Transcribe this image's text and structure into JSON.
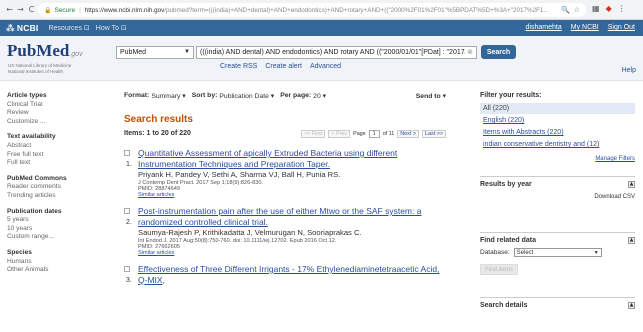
{
  "browser": {
    "back": "←",
    "forward": "→",
    "reload": "C",
    "secure_label": "Secure",
    "url_host": "https://www.ncbi.nlm.nih.gov",
    "url_path": "/pubmed?term=(((india)+AND+dental)+AND+endodontics)+AND+rotary+AND+((\"2000%2F01%2F01\"%5BPDAT%5D+%3A+\"2017%2F1..."
  },
  "ncbi": {
    "logo": "NCBI",
    "resources": "Resources ⊡",
    "howto": "How To ⊡",
    "username": "dishamehta",
    "my_ncbi": "My NCBI",
    "sign_out": "Sign Out"
  },
  "search": {
    "logo_pub": "Pub",
    "logo_med": "Med",
    "logo_gov": ".gov",
    "subtitle_1": "US National Library of Medicine",
    "subtitle_2": "National Institutes of Health",
    "database": "PubMed",
    "query": "(((india) AND dental) AND endodontics) AND rotary AND ((\"2000/01/01\"[PDat] : \"2017/",
    "search_button": "Search",
    "create_rss": "Create RSS",
    "create_alert": "Create alert",
    "advanced": "Advanced",
    "help": "Help"
  },
  "sidebar": [
    {
      "heading": "Article types",
      "items": [
        "Clinical Trial",
        "Review",
        "Customize ..."
      ]
    },
    {
      "heading": "Text availability",
      "items": [
        "Abstract",
        "Free full text",
        "Full text"
      ]
    },
    {
      "heading": "PubMed Commons",
      "items": [
        "Reader comments",
        "Trending articles"
      ]
    },
    {
      "heading": "Publication dates",
      "items": [
        "5 years",
        "10 years",
        "Custom range..."
      ]
    },
    {
      "heading": "Species",
      "items": [
        "Humans",
        "Other Animals"
      ]
    }
  ],
  "main": {
    "format_label": "Format:",
    "format_value": "Summary ▾",
    "sort_label": "Sort by:",
    "sort_value": "Publication Date ▾",
    "perpage_label": "Per page:",
    "perpage_value": "20 ▾",
    "send_to": "Send to ▾",
    "results_title": "Search results",
    "items_text": "Items: 1 to 20 of 220",
    "pager": {
      "first": "<< First",
      "prev": "< Prev",
      "page_label": "Page",
      "page_value": "1",
      "of_text": "of 11",
      "next": "Next >",
      "last": "Last >>"
    },
    "results": [
      {
        "num": "1.",
        "title": "Quantitative Assessment of apically Extruded Bacteria using different Instrumentation Techniques and Preparation Taper.",
        "authors": "Priyank H, Pandey V, Sethi A, Sharma VJ, Ball H, Punia RS.",
        "citation": "J Contemp Dent Pract. 2017 Sep 1;18(9):826-830.",
        "pmid": "PMID: 28874649",
        "similar": "Similar articles"
      },
      {
        "num": "2.",
        "title": "Post-instrumentation pain after the use of either Mtwo or the SAF system: a randomized controlled clinical trial.",
        "authors": "Saumya-Rajesh P, Krithikadatta J, Velmurugan N, Sooriaprakas C.",
        "citation": "Int Endod J. 2017 Aug;50(8):750-760. doi: 10.1111/iej.12702. Epub 2016 Oct 12.",
        "pmid": "PMID: 27662605",
        "similar": "Similar articles"
      },
      {
        "num": "3.",
        "title": "Effectiveness of Three Different Irrigants - 17% Ethylenediaminetetraacetic Acid, Q-MIX,",
        "authors": "",
        "citation": "",
        "pmid": "",
        "similar": ""
      }
    ]
  },
  "right": {
    "filter_head": "Filter your results:",
    "filters": [
      "All (220)",
      "English (220)",
      "Items with Abstracts (220)",
      "indian conservative dentistry and (12)"
    ],
    "manage_filters": "Manage Filters",
    "results_by_year": "Results by year",
    "download_csv": "Download CSV",
    "find_related": "Find related data",
    "database_label": "Database:",
    "database_select": "Select",
    "find_items": "Find items",
    "search_details": "Search details"
  },
  "colors": {
    "ncbi_blue": "#336699",
    "link_blue": "#2a4f9e",
    "results_orange": "#c05000",
    "selected_filter": "#e1e9f5"
  }
}
